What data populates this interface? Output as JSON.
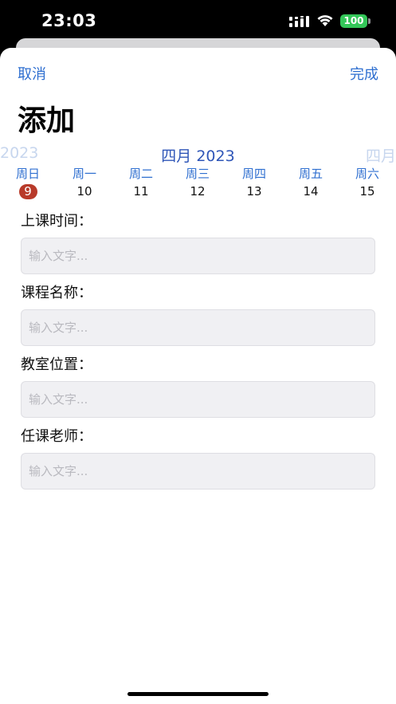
{
  "status_bar": {
    "time": "23:03",
    "battery": "100"
  },
  "nav": {
    "cancel_label": "取消",
    "done_label": "完成"
  },
  "page": {
    "title": "添加"
  },
  "calendar": {
    "prev_month_label": "2023",
    "current_month_label": "四月 2023",
    "next_month_label": "四月",
    "weekdays": [
      "周日",
      "周一",
      "周二",
      "周三",
      "周四",
      "周五",
      "周六"
    ],
    "days": [
      "9",
      "10",
      "11",
      "12",
      "13",
      "14",
      "15"
    ],
    "selected_day": "9"
  },
  "form": {
    "fields": [
      {
        "label": "上课时间：",
        "value": "",
        "placeholder": "输入文字..."
      },
      {
        "label": "课程名称：",
        "value": "",
        "placeholder": "输入文字..."
      },
      {
        "label": "教室位置：",
        "value": "",
        "placeholder": "输入文字..."
      },
      {
        "label": "任课老师：",
        "value": "",
        "placeholder": "输入文字..."
      }
    ]
  },
  "colors": {
    "accent": "#2f6fd0",
    "selected_day": "#b83a2a",
    "battery": "#34c759",
    "input_bg": "#f0f0f3"
  }
}
